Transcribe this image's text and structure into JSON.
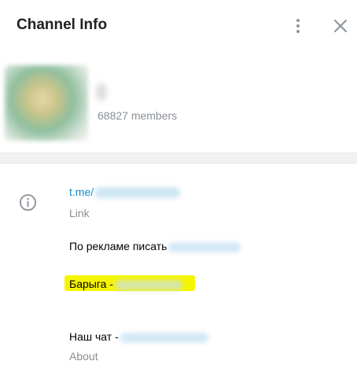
{
  "header": {
    "title": "Channel Info",
    "more_icon": "more-vertical-icon",
    "close_icon": "close-icon"
  },
  "profile": {
    "members": "68827 members"
  },
  "info": {
    "icon": "info-icon",
    "link_prefix": "t.me/",
    "link_caption": "Link",
    "lines": [
      "По рекламе писать",
      "Барыга -",
      "Наш чат -"
    ],
    "about_caption": "About"
  },
  "colors": {
    "accent_link": "#168acd",
    "highlight": "#f5f500",
    "secondary_text": "#8a8f94"
  }
}
